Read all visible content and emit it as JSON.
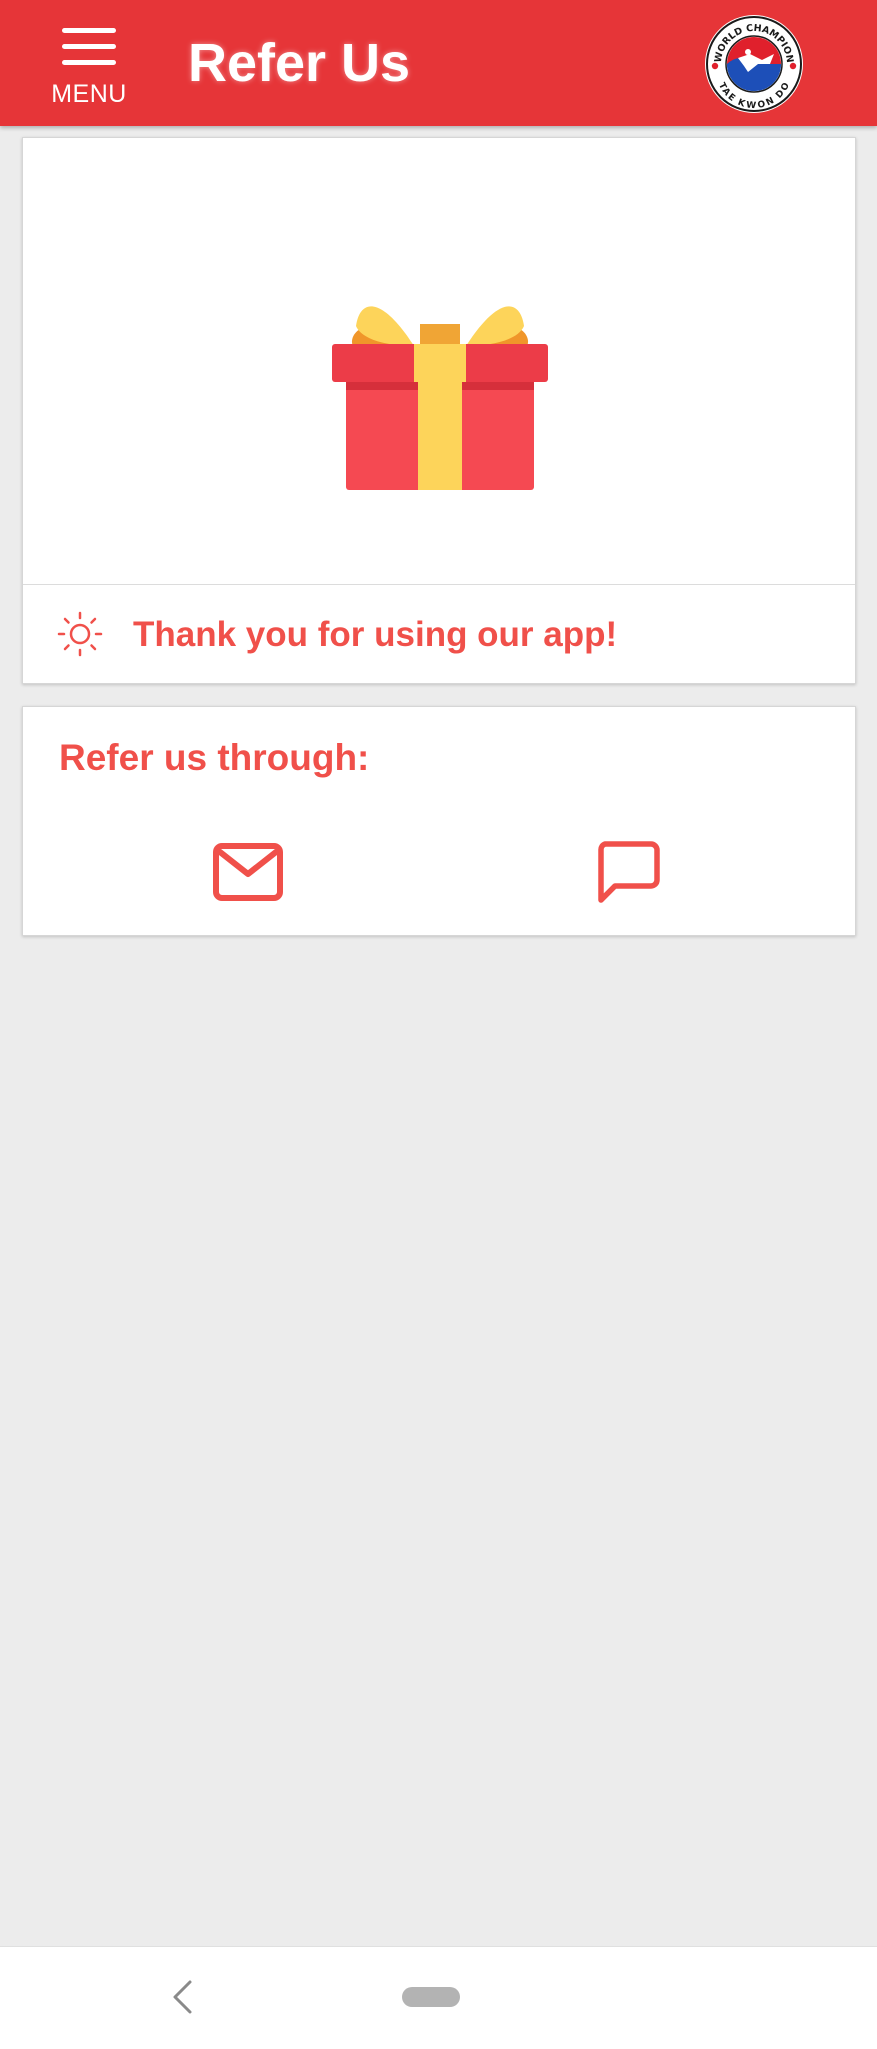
{
  "header": {
    "menu_label": "MENU",
    "title": "Refer Us",
    "background_color": "#e63538",
    "menu_icon": "hamburger-menu-icon",
    "logo": {
      "icon": "taekwondo-logo",
      "text_top": "WORLD CHAMPION",
      "text_bottom": "TAE KWON DO"
    }
  },
  "gift_card": {
    "image": "gift-box-icon",
    "status_icon": "sun-icon",
    "message": "Thank you for using our app!"
  },
  "refer_card": {
    "title": "Refer us through:",
    "options": [
      {
        "icon": "email-icon"
      },
      {
        "icon": "message-icon"
      }
    ]
  },
  "accent_color": "#f0504a",
  "navigation_bar": {
    "back_icon": "back-chevron-icon",
    "home_icon": "home-pill-icon"
  }
}
